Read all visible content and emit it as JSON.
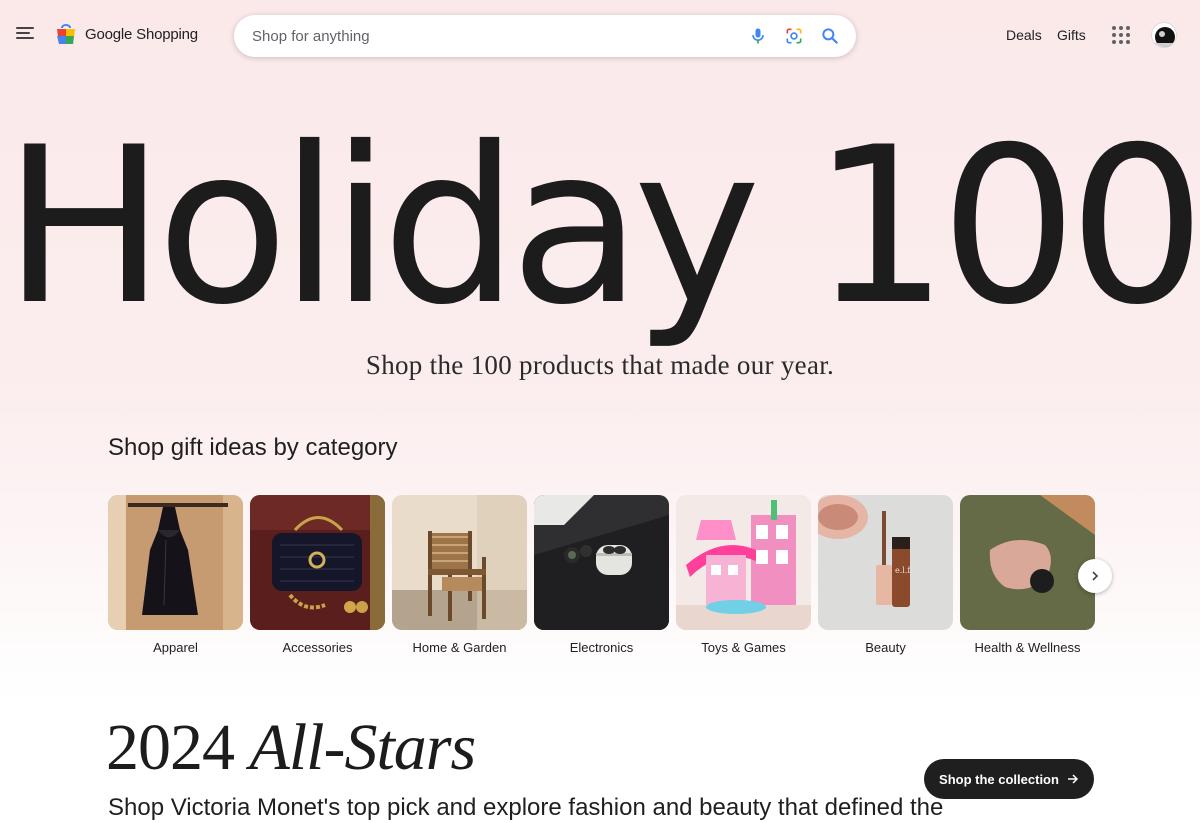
{
  "header": {
    "logo_text": "Google Shopping",
    "search_placeholder": "Shop for anything",
    "search_value": "",
    "nav": [
      "Deals",
      "Gifts"
    ]
  },
  "hero": {
    "title": "Holiday 100",
    "subtitle": "Shop the 100 products that made our year."
  },
  "categories": {
    "title": "Shop gift ideas by category",
    "items": [
      {
        "label": "Apparel"
      },
      {
        "label": "Accessories"
      },
      {
        "label": "Home & Garden"
      },
      {
        "label": "Electronics"
      },
      {
        "label": "Toys & Games"
      },
      {
        "label": "Beauty"
      },
      {
        "label": "Health & Wellness"
      }
    ]
  },
  "allstars": {
    "title_plain": "2024 ",
    "title_italic": "All-Stars",
    "subtitle": "Shop Victoria Monet's top pick and explore fashion and beauty that defined the",
    "cta_label": "Shop the collection"
  },
  "icons": {
    "menu": "menu-icon",
    "logo": "shopping-bag-icon",
    "mic": "microphone-icon",
    "lens": "lens-camera-icon",
    "search": "search-icon",
    "apps": "apps-grid-icon",
    "next": "chevron-right-icon",
    "arrow": "arrow-right-icon"
  },
  "colors": {
    "page_bg_top": "#fbe9ea",
    "cta_bg": "#1f1f1f",
    "google_blue": "#4285f4",
    "google_red": "#ea4335",
    "google_yellow": "#fbbc04",
    "google_green": "#34a853"
  }
}
